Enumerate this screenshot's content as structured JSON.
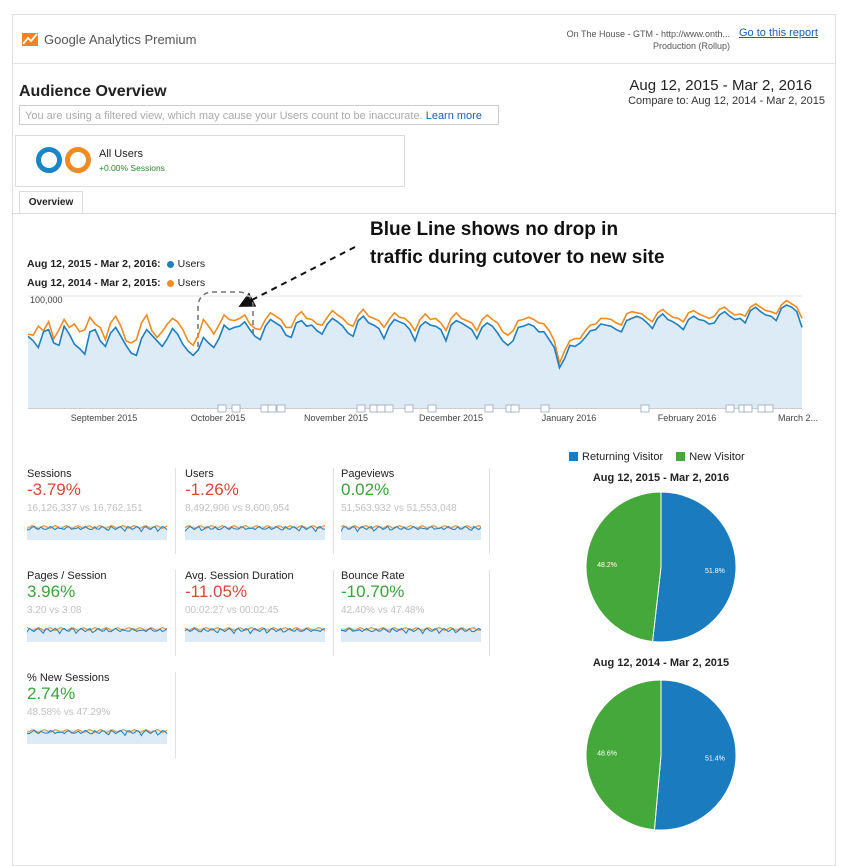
{
  "header": {
    "product": "Google Analytics Premium",
    "view_name": "On The House - GTM - http://www.onth...",
    "view_sub": "Production (Rollup)",
    "goto_link": "Go to this report"
  },
  "report": {
    "title": "Audience Overview",
    "date_range": "Aug 12, 2015 - Mar 2, 2016",
    "compare": "Compare to: Aug 12, 2014 - Mar 2, 2015",
    "filter_notice": "You are using a filtered view, which may cause your Users count to be inaccurate.",
    "learn_more": "Learn more",
    "segment_label": "All Users",
    "segment_sub": "+0.00% Sessions",
    "tab": "Overview"
  },
  "annotation": {
    "line1": "Blue Line  shows no drop in",
    "line2": "traffic during cutover to new site"
  },
  "colors": {
    "blue": "#1f7fbf",
    "orange": "#f08b23",
    "green": "#3aa33a",
    "red": "#d34a3a",
    "pie_blue": "#1a7bbf",
    "pie_green": "#45a83a"
  },
  "chart_data": [
    {
      "type": "line",
      "legend": [
        {
          "period": "Aug 12, 2015 - Mar 2, 2016:",
          "name": "Users"
        },
        {
          "period": "Aug 12, 2014 - Mar 2, 2015:",
          "name": "Users"
        }
      ],
      "ylim": [
        0,
        100000
      ],
      "y_ticks": [
        "100,000",
        "50,000"
      ],
      "x_ticks": [
        "September 2015",
        "October 2015",
        "November 2015",
        "December 2015",
        "January 2016",
        "February 2016",
        "March 2..."
      ],
      "series": [
        {
          "name": "Users",
          "color": "#1f7fbf",
          "values": [
            64000,
            60000,
            54000,
            68000,
            70000,
            58000,
            56000,
            73000,
            66000,
            57000,
            53000,
            48000,
            68000,
            70000,
            60000,
            55000,
            67000,
            72000,
            64000,
            56000,
            49000,
            47000,
            62000,
            70000,
            65000,
            60000,
            55000,
            62000,
            71000,
            66000,
            57000,
            51000,
            47000,
            52000,
            63000,
            58000,
            54000,
            62000,
            74000,
            70000,
            72000,
            73000,
            77000,
            70000,
            64000,
            61000,
            73000,
            79000,
            76000,
            73000,
            65000,
            63000,
            76000,
            78000,
            73000,
            74000,
            69000,
            66000,
            75000,
            80000,
            77000,
            73000,
            67000,
            64000,
            78000,
            82000,
            76000,
            74000,
            71000,
            62000,
            73000,
            79000,
            77000,
            75000,
            70000,
            60000,
            73000,
            77000,
            74000,
            73000,
            70000,
            60000,
            74000,
            78000,
            76000,
            73000,
            70000,
            62000,
            72000,
            76000,
            73000,
            67000,
            60000,
            56000,
            60000,
            72000,
            73000,
            75000,
            73000,
            68000,
            68000,
            61000,
            54000,
            36000,
            44000,
            56000,
            55000,
            58000,
            63000,
            69000,
            70000,
            75000,
            74000,
            73000,
            70000,
            68000,
            78000,
            80000,
            82000,
            80000,
            76000,
            71000,
            80000,
            84000,
            79000,
            77000,
            74000,
            70000,
            79000,
            82000,
            79000,
            78000,
            75000,
            76000,
            83000,
            86000,
            82000,
            79000,
            80000,
            76000,
            87000,
            90000,
            86000,
            83000,
            82000,
            78000,
            89000,
            92000,
            90000,
            86000,
            72000
          ]
        },
        {
          "name": "Users",
          "color": "#f08b23",
          "values": [
            66000,
            65000,
            73000,
            69000,
            77000,
            62000,
            70000,
            79000,
            72000,
            75000,
            68000,
            70000,
            81000,
            75000,
            72000,
            61000,
            76000,
            82000,
            73000,
            60000,
            58000,
            61000,
            76000,
            83000,
            69000,
            63000,
            68000,
            75000,
            80000,
            77000,
            70000,
            60000,
            56000,
            65000,
            79000,
            73000,
            66000,
            74000,
            83000,
            79000,
            78000,
            80000,
            83000,
            75000,
            71000,
            70000,
            79000,
            85000,
            82000,
            79000,
            72000,
            72000,
            82000,
            86000,
            80000,
            79000,
            75000,
            74000,
            81000,
            87000,
            83000,
            80000,
            75000,
            73000,
            83000,
            88000,
            82000,
            80000,
            78000,
            72000,
            79000,
            85000,
            81000,
            80000,
            76000,
            69000,
            79000,
            84000,
            79000,
            80000,
            76000,
            69000,
            80000,
            85000,
            80000,
            78000,
            76000,
            69000,
            79000,
            83000,
            79000,
            76000,
            68000,
            65000,
            69000,
            78000,
            79000,
            81000,
            79000,
            76000,
            75000,
            69000,
            60000,
            40000,
            51000,
            60000,
            62000,
            62000,
            69000,
            74000,
            75000,
            80000,
            80000,
            79000,
            76000,
            74000,
            84000,
            86000,
            85000,
            84000,
            80000,
            77000,
            85000,
            88000,
            84000,
            81000,
            80000,
            77000,
            85000,
            87000,
            84000,
            82000,
            80000,
            82000,
            88000,
            90000,
            86000,
            83000,
            84000,
            82000,
            90000,
            93000,
            90000,
            87000,
            86000,
            84000,
            92000,
            96000,
            93000,
            90000,
            80000
          ]
        }
      ]
    },
    {
      "type": "pie",
      "legend": [
        "Returning Visitor",
        "New Visitor"
      ],
      "charts": [
        {
          "title": "Aug 12, 2015 - Mar 2, 2016",
          "slices": [
            {
              "name": "Returning Visitor",
              "value": 51.8,
              "label": "51.8%"
            },
            {
              "name": "New Visitor",
              "value": 48.2,
              "label": "48.2%"
            }
          ]
        },
        {
          "title": "Aug 12, 2014 - Mar 2, 2015",
          "slices": [
            {
              "name": "Returning Visitor",
              "value": 51.4,
              "label": "51.4%"
            },
            {
              "name": "New Visitor",
              "value": 48.6,
              "label": "48.6%"
            }
          ]
        }
      ]
    }
  ],
  "metrics": [
    {
      "label": "Sessions",
      "value": "-3.79%",
      "trend": "down",
      "compare": "16,126,337 vs 16,762,151"
    },
    {
      "label": "Users",
      "value": "-1.26%",
      "trend": "down",
      "compare": "8,492,906 vs 8,600,954"
    },
    {
      "label": "Pageviews",
      "value": "0.02%",
      "trend": "up",
      "compare": "51,563,932 vs 51,553,048"
    },
    {
      "label": "Pages / Session",
      "value": "3.96%",
      "trend": "up",
      "compare": "3.20 vs 3.08"
    },
    {
      "label": "Avg. Session Duration",
      "value": "-11.05%",
      "trend": "down",
      "compare": "00:02:27 vs 00:02:45"
    },
    {
      "label": "Bounce Rate",
      "value": "-10.70%",
      "trend": "up",
      "compare": "42.40% vs 47.48%"
    },
    {
      "label": "% New Sessions",
      "value": "2.74%",
      "trend": "up",
      "compare": "48.58% vs 47.29%"
    }
  ]
}
